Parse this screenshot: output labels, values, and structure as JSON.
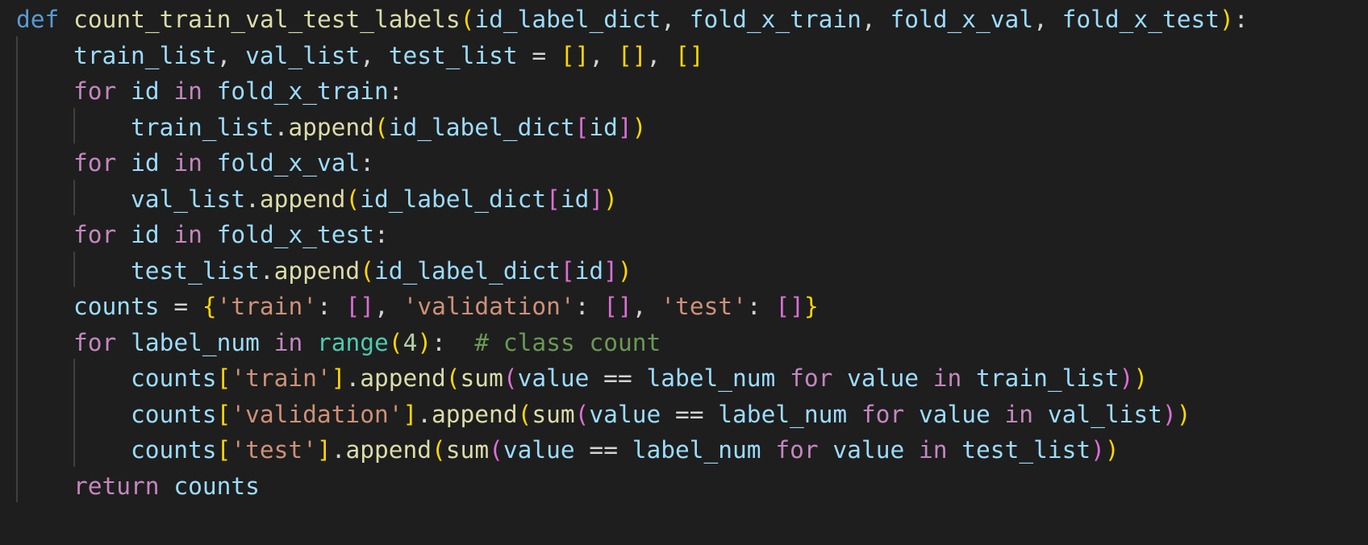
{
  "editor": {
    "language": "python",
    "colors": {
      "background": "#1e1e1e",
      "keyword": "#569cd6",
      "control": "#c586c0",
      "function": "#dcdcaa",
      "variable": "#9cdcfe",
      "string": "#ce9178",
      "number": "#b5cea8",
      "builtin": "#4ec9b0",
      "comment": "#6a9955",
      "bracket_level_1": "#ffd700",
      "bracket_level_2": "#da70d6"
    },
    "lines": [
      {
        "indent": 0,
        "tokens": [
          {
            "t": "def",
            "c": "kw"
          },
          {
            "t": " ",
            "c": "plain"
          },
          {
            "t": "count_train_val_test_labels",
            "c": "fn"
          },
          {
            "t": "(",
            "c": "b1"
          },
          {
            "t": "id_label_dict",
            "c": "var"
          },
          {
            "t": ", ",
            "c": "plain"
          },
          {
            "t": "fold_x_train",
            "c": "var"
          },
          {
            "t": ", ",
            "c": "plain"
          },
          {
            "t": "fold_x_val",
            "c": "var"
          },
          {
            "t": ", ",
            "c": "plain"
          },
          {
            "t": "fold_x_test",
            "c": "var"
          },
          {
            "t": ")",
            "c": "b1"
          },
          {
            "t": ":",
            "c": "plain"
          }
        ]
      },
      {
        "indent": 1,
        "tokens": [
          {
            "t": "train_list",
            "c": "var"
          },
          {
            "t": ", ",
            "c": "plain"
          },
          {
            "t": "val_list",
            "c": "var"
          },
          {
            "t": ", ",
            "c": "plain"
          },
          {
            "t": "test_list",
            "c": "var"
          },
          {
            "t": " = ",
            "c": "plain"
          },
          {
            "t": "[]",
            "c": "b1"
          },
          {
            "t": ", ",
            "c": "plain"
          },
          {
            "t": "[]",
            "c": "b1"
          },
          {
            "t": ", ",
            "c": "plain"
          },
          {
            "t": "[]",
            "c": "b1"
          }
        ]
      },
      {
        "indent": 1,
        "tokens": [
          {
            "t": "for",
            "c": "ctl"
          },
          {
            "t": " ",
            "c": "plain"
          },
          {
            "t": "id",
            "c": "var"
          },
          {
            "t": " ",
            "c": "plain"
          },
          {
            "t": "in",
            "c": "ctl"
          },
          {
            "t": " ",
            "c": "plain"
          },
          {
            "t": "fold_x_train",
            "c": "var"
          },
          {
            "t": ":",
            "c": "plain"
          }
        ]
      },
      {
        "indent": 2,
        "tokens": [
          {
            "t": "train_list",
            "c": "var"
          },
          {
            "t": ".",
            "c": "plain"
          },
          {
            "t": "append",
            "c": "fn"
          },
          {
            "t": "(",
            "c": "b1"
          },
          {
            "t": "id_label_dict",
            "c": "var"
          },
          {
            "t": "[",
            "c": "b2"
          },
          {
            "t": "id",
            "c": "var"
          },
          {
            "t": "]",
            "c": "b2"
          },
          {
            "t": ")",
            "c": "b1"
          }
        ]
      },
      {
        "indent": 1,
        "tokens": [
          {
            "t": "for",
            "c": "ctl"
          },
          {
            "t": " ",
            "c": "plain"
          },
          {
            "t": "id",
            "c": "var"
          },
          {
            "t": " ",
            "c": "plain"
          },
          {
            "t": "in",
            "c": "ctl"
          },
          {
            "t": " ",
            "c": "plain"
          },
          {
            "t": "fold_x_val",
            "c": "var"
          },
          {
            "t": ":",
            "c": "plain"
          }
        ]
      },
      {
        "indent": 2,
        "tokens": [
          {
            "t": "val_list",
            "c": "var"
          },
          {
            "t": ".",
            "c": "plain"
          },
          {
            "t": "append",
            "c": "fn"
          },
          {
            "t": "(",
            "c": "b1"
          },
          {
            "t": "id_label_dict",
            "c": "var"
          },
          {
            "t": "[",
            "c": "b2"
          },
          {
            "t": "id",
            "c": "var"
          },
          {
            "t": "]",
            "c": "b2"
          },
          {
            "t": ")",
            "c": "b1"
          }
        ]
      },
      {
        "indent": 1,
        "tokens": [
          {
            "t": "for",
            "c": "ctl"
          },
          {
            "t": " ",
            "c": "plain"
          },
          {
            "t": "id",
            "c": "var"
          },
          {
            "t": " ",
            "c": "plain"
          },
          {
            "t": "in",
            "c": "ctl"
          },
          {
            "t": " ",
            "c": "plain"
          },
          {
            "t": "fold_x_test",
            "c": "var"
          },
          {
            "t": ":",
            "c": "plain"
          }
        ]
      },
      {
        "indent": 2,
        "tokens": [
          {
            "t": "test_list",
            "c": "var"
          },
          {
            "t": ".",
            "c": "plain"
          },
          {
            "t": "append",
            "c": "fn"
          },
          {
            "t": "(",
            "c": "b1"
          },
          {
            "t": "id_label_dict",
            "c": "var"
          },
          {
            "t": "[",
            "c": "b2"
          },
          {
            "t": "id",
            "c": "var"
          },
          {
            "t": "]",
            "c": "b2"
          },
          {
            "t": ")",
            "c": "b1"
          }
        ]
      },
      {
        "indent": 1,
        "tokens": [
          {
            "t": "counts",
            "c": "var"
          },
          {
            "t": " = ",
            "c": "plain"
          },
          {
            "t": "{",
            "c": "b1"
          },
          {
            "t": "'train'",
            "c": "str"
          },
          {
            "t": ": ",
            "c": "plain"
          },
          {
            "t": "[]",
            "c": "b2"
          },
          {
            "t": ", ",
            "c": "plain"
          },
          {
            "t": "'validation'",
            "c": "str"
          },
          {
            "t": ": ",
            "c": "plain"
          },
          {
            "t": "[]",
            "c": "b2"
          },
          {
            "t": ", ",
            "c": "plain"
          },
          {
            "t": "'test'",
            "c": "str"
          },
          {
            "t": ": ",
            "c": "plain"
          },
          {
            "t": "[]",
            "c": "b2"
          },
          {
            "t": "}",
            "c": "b1"
          }
        ]
      },
      {
        "indent": 1,
        "tokens": [
          {
            "t": "for",
            "c": "ctl"
          },
          {
            "t": " ",
            "c": "plain"
          },
          {
            "t": "label_num",
            "c": "var"
          },
          {
            "t": " ",
            "c": "plain"
          },
          {
            "t": "in",
            "c": "ctl"
          },
          {
            "t": " ",
            "c": "plain"
          },
          {
            "t": "range",
            "c": "cls"
          },
          {
            "t": "(",
            "c": "b1"
          },
          {
            "t": "4",
            "c": "num"
          },
          {
            "t": ")",
            "c": "b1"
          },
          {
            "t": ":  ",
            "c": "plain"
          },
          {
            "t": "# class count",
            "c": "cmt"
          }
        ]
      },
      {
        "indent": 2,
        "tokens": [
          {
            "t": "counts",
            "c": "var"
          },
          {
            "t": "[",
            "c": "b1"
          },
          {
            "t": "'train'",
            "c": "str"
          },
          {
            "t": "]",
            "c": "b1"
          },
          {
            "t": ".",
            "c": "plain"
          },
          {
            "t": "append",
            "c": "fn"
          },
          {
            "t": "(",
            "c": "b1"
          },
          {
            "t": "sum",
            "c": "fn"
          },
          {
            "t": "(",
            "c": "b2"
          },
          {
            "t": "value",
            "c": "var"
          },
          {
            "t": " == ",
            "c": "plain"
          },
          {
            "t": "label_num",
            "c": "var"
          },
          {
            "t": " ",
            "c": "plain"
          },
          {
            "t": "for",
            "c": "ctl"
          },
          {
            "t": " ",
            "c": "plain"
          },
          {
            "t": "value",
            "c": "var"
          },
          {
            "t": " ",
            "c": "plain"
          },
          {
            "t": "in",
            "c": "ctl"
          },
          {
            "t": " ",
            "c": "plain"
          },
          {
            "t": "train_list",
            "c": "var"
          },
          {
            "t": ")",
            "c": "b2"
          },
          {
            "t": ")",
            "c": "b1"
          }
        ]
      },
      {
        "indent": 2,
        "tokens": [
          {
            "t": "counts",
            "c": "var"
          },
          {
            "t": "[",
            "c": "b1"
          },
          {
            "t": "'validation'",
            "c": "str"
          },
          {
            "t": "]",
            "c": "b1"
          },
          {
            "t": ".",
            "c": "plain"
          },
          {
            "t": "append",
            "c": "fn"
          },
          {
            "t": "(",
            "c": "b1"
          },
          {
            "t": "sum",
            "c": "fn"
          },
          {
            "t": "(",
            "c": "b2"
          },
          {
            "t": "value",
            "c": "var"
          },
          {
            "t": " == ",
            "c": "plain"
          },
          {
            "t": "label_num",
            "c": "var"
          },
          {
            "t": " ",
            "c": "plain"
          },
          {
            "t": "for",
            "c": "ctl"
          },
          {
            "t": " ",
            "c": "plain"
          },
          {
            "t": "value",
            "c": "var"
          },
          {
            "t": " ",
            "c": "plain"
          },
          {
            "t": "in",
            "c": "ctl"
          },
          {
            "t": " ",
            "c": "plain"
          },
          {
            "t": "val_list",
            "c": "var"
          },
          {
            "t": ")",
            "c": "b2"
          },
          {
            "t": ")",
            "c": "b1"
          }
        ]
      },
      {
        "indent": 2,
        "tokens": [
          {
            "t": "counts",
            "c": "var"
          },
          {
            "t": "[",
            "c": "b1"
          },
          {
            "t": "'test'",
            "c": "str"
          },
          {
            "t": "]",
            "c": "b1"
          },
          {
            "t": ".",
            "c": "plain"
          },
          {
            "t": "append",
            "c": "fn"
          },
          {
            "t": "(",
            "c": "b1"
          },
          {
            "t": "sum",
            "c": "fn"
          },
          {
            "t": "(",
            "c": "b2"
          },
          {
            "t": "value",
            "c": "var"
          },
          {
            "t": " == ",
            "c": "plain"
          },
          {
            "t": "label_num",
            "c": "var"
          },
          {
            "t": " ",
            "c": "plain"
          },
          {
            "t": "for",
            "c": "ctl"
          },
          {
            "t": " ",
            "c": "plain"
          },
          {
            "t": "value",
            "c": "var"
          },
          {
            "t": " ",
            "c": "plain"
          },
          {
            "t": "in",
            "c": "ctl"
          },
          {
            "t": " ",
            "c": "plain"
          },
          {
            "t": "test_list",
            "c": "var"
          },
          {
            "t": ")",
            "c": "b2"
          },
          {
            "t": ")",
            "c": "b1"
          }
        ]
      },
      {
        "indent": 1,
        "tokens": [
          {
            "t": "return",
            "c": "ctl"
          },
          {
            "t": " ",
            "c": "plain"
          },
          {
            "t": "counts",
            "c": "var"
          }
        ]
      }
    ]
  }
}
